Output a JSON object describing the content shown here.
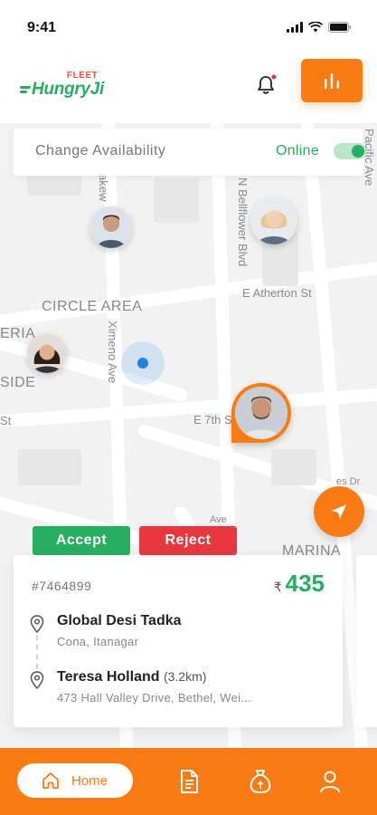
{
  "status_bar": {
    "time": "9:41"
  },
  "header": {
    "logo_brand": "HungryJi",
    "logo_tag": "FLEET",
    "has_notification": true
  },
  "availability": {
    "label": "Change Availability",
    "status": "Online",
    "enabled": true
  },
  "map": {
    "labels": {
      "circle_area": "CIRCLE AREA",
      "eria": "ERIA",
      "side": "SIDE",
      "st": "St",
      "atherton": "E Atherton St",
      "seventh": "E 7th S",
      "bellflower": "N Bellflower Blvd",
      "ximeno": "Ximeno Ave",
      "bakew": "akew",
      "marina": "MARINA",
      "pacific": "Pacific Ave",
      "ave": "Ave",
      "es_dr": "es Dr"
    }
  },
  "actions": {
    "accept": "Accept",
    "reject": "Reject"
  },
  "order": {
    "id": "#7464899",
    "currency": "₹",
    "amount": "435",
    "pickup": {
      "name": "Global Desi Tadka",
      "address": "Cona, Itanagar"
    },
    "drop": {
      "name": "Teresa Holland",
      "distance": "(3.2km)",
      "address": "473 Hall Valley Drive, Bethel, Wei..."
    }
  },
  "nav": {
    "home": "Home"
  },
  "colors": {
    "accent": "#fa7b14",
    "success": "#27ae60",
    "danger": "#e8373f",
    "location": "#1e82e6"
  }
}
